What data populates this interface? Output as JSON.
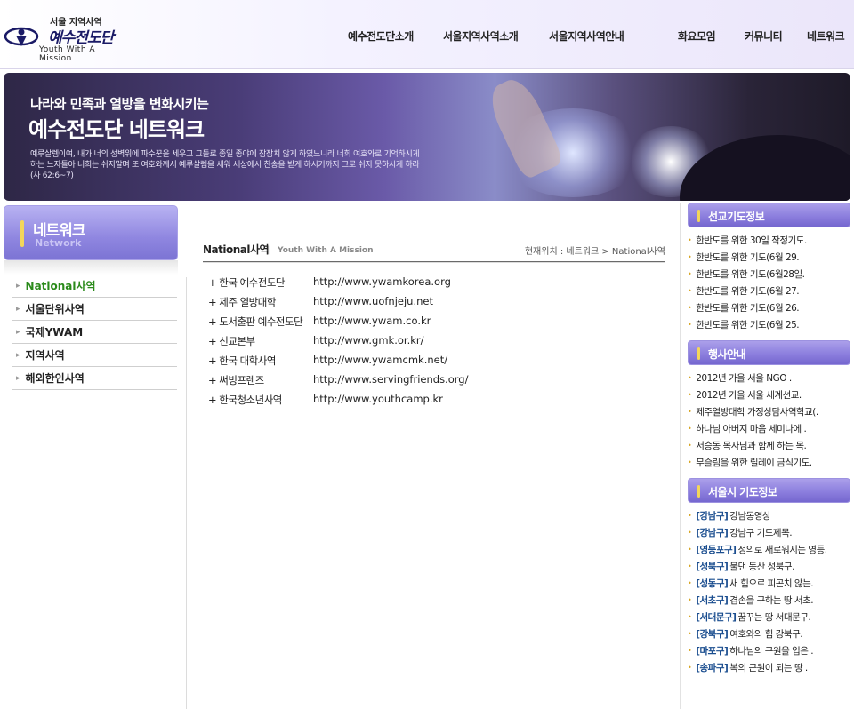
{
  "logo": {
    "top_text": "서울 지역사역",
    "main_text": "예수전도단",
    "sub_text": "Youth With A Mission"
  },
  "nav": {
    "items": [
      "예수전도단소개",
      "서울지역사역소개",
      "서울지역사역안내",
      "화요모임",
      "커뮤니티",
      "네트워크"
    ]
  },
  "banner": {
    "line1": "나라와 민족과 열방을 변화시키는",
    "line2": "예수전도단 네트워크",
    "line3": "예루살렘이여, 내가 너의 성벽위에 파수꾼을 세우고 그들로 종일 종야에 잠잠치 않게 하였느니라 너희 여호와로 기억하시게 하는 느자들아 너희는 쉬지말며 또 여호와께서 예루살렘을 세워 세상에서 찬송을 받게 하시기까지 그로 쉬지 못하시게 하라(사 62:6~7)"
  },
  "side": {
    "title": "네트워크",
    "title_en": "Network",
    "menu": [
      "National사역",
      "서울단위사역",
      "국제YWAM",
      "지역사역",
      "해외한인사역"
    ]
  },
  "content": {
    "title": "National사역",
    "separator": "|",
    "subtitle": "Youth With A Mission",
    "location": "현재위치 : 네트워크 > National사역",
    "links": [
      {
        "name": "+ 한국 예수전도단",
        "url": "http://www.ywamkorea.org"
      },
      {
        "name": "+ 제주 열방대학",
        "url": "http://www.uofnjeju.net"
      },
      {
        "name": "+ 도서출판 예수전도단",
        "url": "http://www.ywam.co.kr"
      },
      {
        "name": "+ 선교본부",
        "url": "http://www.gmk.or.kr/"
      },
      {
        "name": "+ 한국 대학사역",
        "url": "http://www.ywamcmk.net/"
      },
      {
        "name": "+ 써빙프렌즈",
        "url": "http://www.servingfriends.org/"
      },
      {
        "name": "+ 한국청소년사역",
        "url": "http://www.youthcamp.kr"
      }
    ]
  },
  "right": {
    "mission": {
      "title": "선교기도정보",
      "items": [
        "한반도를 위한 30일 작정기도.",
        "한반도를 위한 기도(6월 29.",
        "한반도를 위한 기도(6월28일.",
        "한반도를 위한 기도(6월 27.",
        "한반도를 위한 기도(6월 26.",
        "한반도를 위한 기도(6월 25."
      ]
    },
    "events": {
      "title": "행사안내",
      "items": [
        "2012년 가을 서울 NGO .",
        "2012년 가을 서울 세계선교.",
        "제주열방대학 가정상담사역학교(.",
        "하나님 아버지 마음 세미나에 .",
        "서승동 목사님과 함께 하는 목.",
        "무슬림을 위한 릴레이 금식기도."
      ]
    },
    "seoul": {
      "title": "서울시 기도정보",
      "items": [
        {
          "tag": "[강남구]",
          "text": "강남동영상"
        },
        {
          "tag": "[강남구]",
          "text": "강남구 기도제목."
        },
        {
          "tag": "[영등포구]",
          "text": "정의로 새로워지는 영등."
        },
        {
          "tag": "[성북구]",
          "text": "물댄 동산 성북구."
        },
        {
          "tag": "[성동구]",
          "text": "새 힘으로 피곤치 않는."
        },
        {
          "tag": "[서초구]",
          "text": "겸손을 구하는 땅 서초."
        },
        {
          "tag": "[서대문구]",
          "text": "꿈꾸는 땅 서대문구."
        },
        {
          "tag": "[강북구]",
          "text": "여호와의 힘 강북구."
        },
        {
          "tag": "[마포구]",
          "text": "하나님의 구원을 입은 ."
        },
        {
          "tag": "[송파구]",
          "text": "복의 근원이 되는 땅 ."
        }
      ]
    }
  }
}
